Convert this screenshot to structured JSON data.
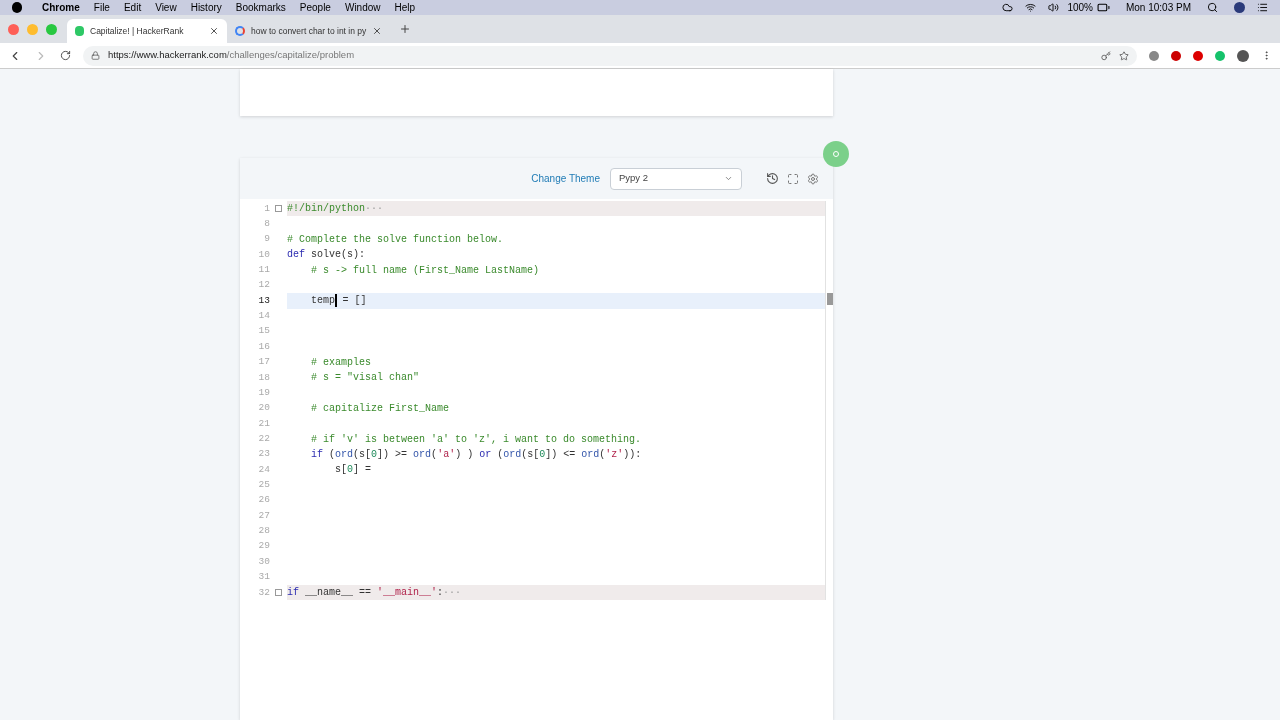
{
  "menubar": {
    "app": "Chrome",
    "items": [
      "File",
      "Edit",
      "View",
      "History",
      "Bookmarks",
      "People",
      "Window",
      "Help"
    ],
    "battery": "100%",
    "clock": "Mon 10:03 PM"
  },
  "tabs": [
    {
      "title": "Capitalize! | HackerRank",
      "selected": true,
      "kind": "hackerrank"
    },
    {
      "title": "how to convert char to int in py",
      "selected": false,
      "kind": "google"
    }
  ],
  "address": {
    "scheme_host": "https://www.hackerrank.com",
    "path": "/challenges/capitalize/problem"
  },
  "editor": {
    "change_theme": "Change Theme",
    "language": "Pypy 2",
    "lines": [
      {
        "number": "1",
        "active": false,
        "folded": true,
        "fold_marker": "···",
        "tokens": [
          {
            "kind": "comment",
            "text": "#!/bin/python"
          }
        ]
      },
      {
        "number": "8",
        "active": false,
        "folded": false
      },
      {
        "number": "9",
        "active": false,
        "folded": false,
        "tokens": [
          {
            "kind": "comment",
            "text": "# Complete the solve function below."
          }
        ]
      },
      {
        "number": "10",
        "active": false,
        "folded": false,
        "tokens": [
          {
            "kind": "keyword",
            "text": "def"
          },
          {
            "kind": "plain",
            "text": " solve(s):"
          }
        ]
      },
      {
        "number": "11",
        "active": false,
        "folded": false,
        "tokens": [
          {
            "kind": "comment",
            "text": "    # s -> full name (First_Name LastName)"
          }
        ]
      },
      {
        "number": "12",
        "active": false,
        "folded": false
      },
      {
        "number": "13",
        "active": true,
        "folded": false,
        "tokens": [
          {
            "kind": "plain",
            "text": "    temp",
            "cursor_after": true
          },
          {
            "kind": "plain",
            "text": " = []"
          }
        ]
      },
      {
        "number": "14",
        "active": false,
        "folded": false
      },
      {
        "number": "15",
        "active": false,
        "folded": false
      },
      {
        "number": "16",
        "active": false,
        "folded": false
      },
      {
        "number": "17",
        "active": false,
        "folded": false,
        "tokens": [
          {
            "kind": "comment",
            "text": "    # examples"
          }
        ]
      },
      {
        "number": "18",
        "active": false,
        "folded": false,
        "tokens": [
          {
            "kind": "comment",
            "text": "    # s = \"visal chan\""
          }
        ]
      },
      {
        "number": "19",
        "active": false,
        "folded": false
      },
      {
        "number": "20",
        "active": false,
        "folded": false,
        "tokens": [
          {
            "kind": "comment",
            "text": "    # capitalize First_Name"
          }
        ]
      },
      {
        "number": "21",
        "active": false,
        "folded": false
      },
      {
        "number": "22",
        "active": false,
        "folded": false,
        "tokens": [
          {
            "kind": "comment",
            "text": "    # if 'v' is between 'a' to 'z', i want to do something."
          }
        ]
      },
      {
        "number": "23",
        "active": false,
        "folded": false,
        "tokens": [
          {
            "kind": "keyword",
            "text": "    if"
          },
          {
            "kind": "plain",
            "text": " ("
          },
          {
            "kind": "builtin",
            "text": "ord"
          },
          {
            "kind": "plain",
            "text": "(s["
          },
          {
            "kind": "number",
            "text": "0"
          },
          {
            "kind": "plain",
            "text": "]) >= "
          },
          {
            "kind": "builtin",
            "text": "ord"
          },
          {
            "kind": "plain",
            "text": "("
          },
          {
            "kind": "string",
            "text": "'a'"
          },
          {
            "kind": "plain",
            "text": ") ) "
          },
          {
            "kind": "keyword",
            "text": "or"
          },
          {
            "kind": "plain",
            "text": " ("
          },
          {
            "kind": "builtin",
            "text": "ord"
          },
          {
            "kind": "plain",
            "text": "(s["
          },
          {
            "kind": "number",
            "text": "0"
          },
          {
            "kind": "plain",
            "text": "]) <= "
          },
          {
            "kind": "builtin",
            "text": "ord"
          },
          {
            "kind": "plain",
            "text": "("
          },
          {
            "kind": "string",
            "text": "'z'"
          },
          {
            "kind": "plain",
            "text": ")):"
          }
        ]
      },
      {
        "number": "24",
        "active": false,
        "folded": false,
        "tokens": [
          {
            "kind": "plain",
            "text": "        s["
          },
          {
            "kind": "number",
            "text": "0"
          },
          {
            "kind": "plain",
            "text": "] ="
          }
        ]
      },
      {
        "number": "25",
        "active": false,
        "folded": false
      },
      {
        "number": "26",
        "active": false,
        "folded": false
      },
      {
        "number": "27",
        "active": false,
        "folded": false
      },
      {
        "number": "28",
        "active": false,
        "folded": false
      },
      {
        "number": "29",
        "active": false,
        "folded": false
      },
      {
        "number": "30",
        "active": false,
        "folded": false
      },
      {
        "number": "31",
        "active": false,
        "folded": false
      },
      {
        "number": "32",
        "active": false,
        "folded": true,
        "fold_marker": "···",
        "tokens": [
          {
            "kind": "keyword",
            "text": "if"
          },
          {
            "kind": "plain",
            "text": " __name__ == "
          },
          {
            "kind": "string",
            "text": "'__main__'"
          },
          {
            "kind": "plain",
            "text": ":"
          }
        ]
      }
    ]
  }
}
